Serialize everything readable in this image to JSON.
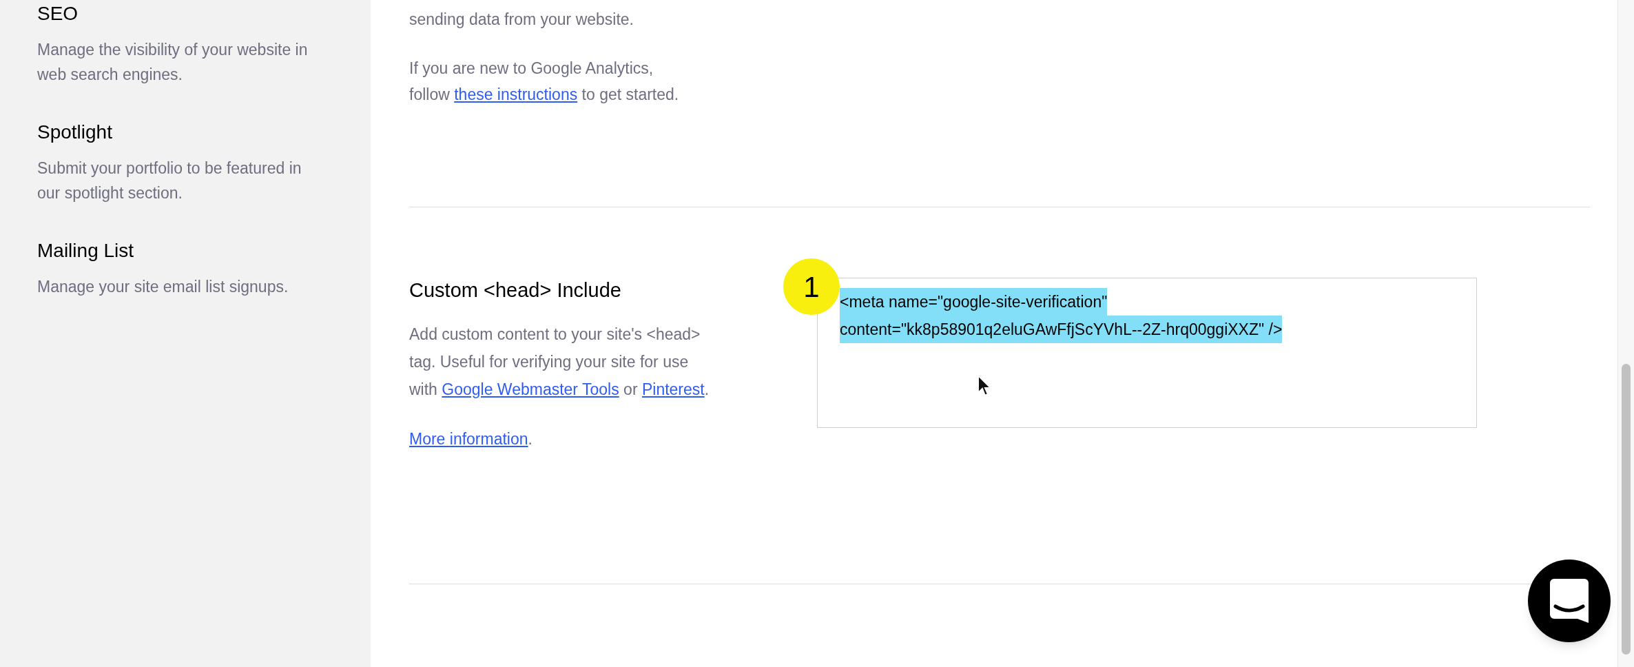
{
  "sidebar": {
    "items": [
      {
        "title": "SEO",
        "description": "Manage the visibility of your website in web search engines."
      },
      {
        "title": "Spotlight",
        "description": "Submit your portfolio to be featured in our spotlight section."
      },
      {
        "title": "Mailing List",
        "description": "Manage your site email list signups."
      }
    ]
  },
  "analytics": {
    "text": "sending data from your website.",
    "intro": "If you are new to Google Analytics,",
    "follow_before": "follow",
    "follow_link": "these instructions",
    "follow_after": "to get started."
  },
  "head_include": {
    "title": "Custom <head> Include",
    "description_parts": [
      {
        "text": "Add custom content to your site's <head> tag. Useful for verifying your site for use with "
      },
      {
        "link": "Google Webmaster Tools"
      },
      {
        "text": " or "
      },
      {
        "link": "Pinterest"
      },
      {
        "text": "."
      }
    ],
    "more_link": "More information",
    "more_after": ".",
    "badge": "1",
    "field": {
      "value_lines": [
        "<meta name=\"google-site-verification\"",
        "content=\"kk8p58901q2eluGAwFfjScYVhL--2Z-hrq00ggiXXZ\" />"
      ],
      "selected": true
    }
  }
}
